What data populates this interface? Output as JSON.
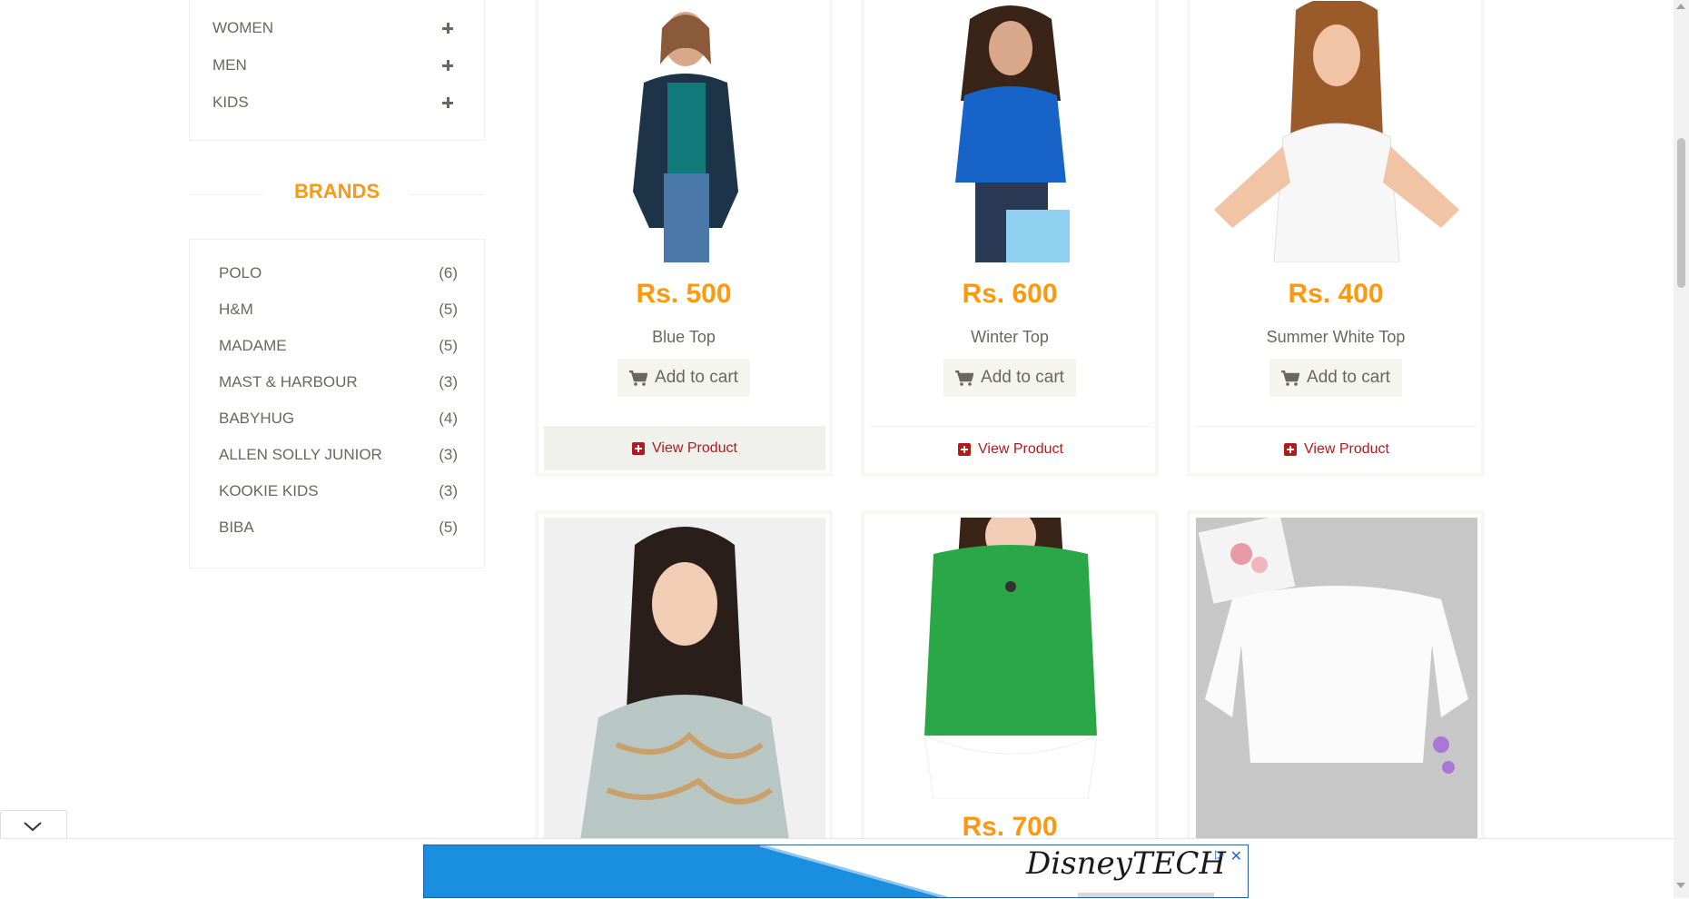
{
  "sidebar": {
    "categories": [
      {
        "label": "WOMEN"
      },
      {
        "label": "MEN"
      },
      {
        "label": "KIDS"
      }
    ],
    "brands_title": "BRANDS",
    "brands": [
      {
        "name": "POLO",
        "count": "(6)"
      },
      {
        "name": "H&M",
        "count": "(5)"
      },
      {
        "name": "MADAME",
        "count": "(5)"
      },
      {
        "name": "MAST & HARBOUR",
        "count": "(3)"
      },
      {
        "name": "BABYHUG",
        "count": "(4)"
      },
      {
        "name": "ALLEN SOLLY JUNIOR",
        "count": "(3)"
      },
      {
        "name": "KOOKIE KIDS",
        "count": "(3)"
      },
      {
        "name": "BIBA",
        "count": "(5)"
      }
    ]
  },
  "products": [
    {
      "price": "Rs. 500",
      "name": "Blue Top",
      "add_label": "Add to cart",
      "view_label": "View Product"
    },
    {
      "price": "Rs. 600",
      "name": "Winter Top",
      "add_label": "Add to cart",
      "view_label": "View Product"
    },
    {
      "price": "Rs. 400",
      "name": "Summer White Top",
      "add_label": "Add to cart",
      "view_label": "View Product"
    },
    {
      "price": "",
      "name": ""
    },
    {
      "price": "Rs. 700",
      "name": ""
    },
    {
      "price": "",
      "name": ""
    }
  ],
  "ad": {
    "logo_text": "DisneyTECH",
    "close_symbol": "✕",
    "adchoices_symbol": "▷"
  },
  "colors": {
    "accent": "#fe980f",
    "link": "#b31b1b",
    "text": "#696763"
  }
}
